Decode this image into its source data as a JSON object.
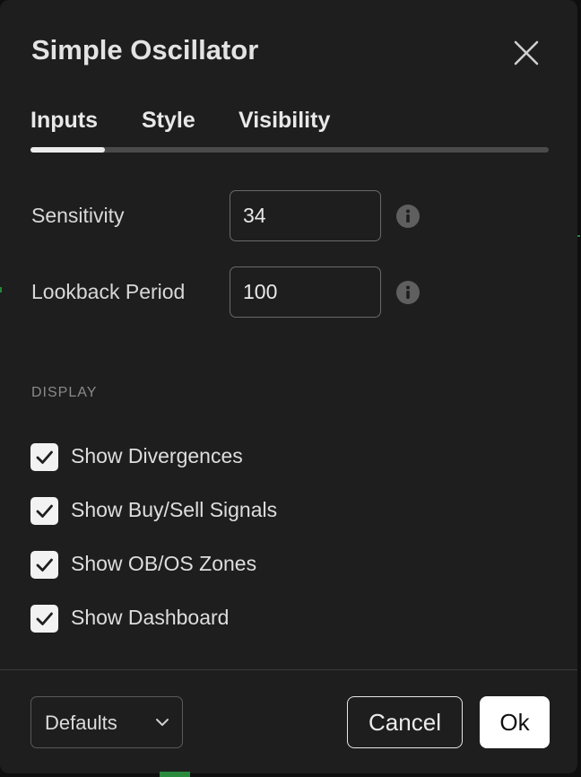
{
  "dialog": {
    "title": "Simple Oscillator",
    "close_icon": "close-icon"
  },
  "tabs": [
    {
      "label": "Inputs",
      "active": true
    },
    {
      "label": "Style",
      "active": false
    },
    {
      "label": "Visibility",
      "active": false
    }
  ],
  "inputs": {
    "sensitivity": {
      "label": "Sensitivity",
      "value": "34",
      "icon": "info-icon"
    },
    "lookback": {
      "label": "Lookback Period",
      "value": "100",
      "icon": "info-icon"
    }
  },
  "display": {
    "heading": "DISPLAY",
    "options": [
      {
        "label": "Show Divergences",
        "checked": true
      },
      {
        "label": "Show Buy/Sell Signals",
        "checked": true
      },
      {
        "label": "Show OB/OS Zones",
        "checked": true
      },
      {
        "label": "Show Dashboard",
        "checked": true
      }
    ]
  },
  "footer": {
    "defaults_label": "Defaults",
    "defaults_icon": "chevron-down-icon",
    "cancel_label": "Cancel",
    "ok_label": "Ok"
  },
  "colors": {
    "dialog_bg": "#1e1e1e",
    "checkbox": "#f2f2f2",
    "primary_button": "#ffffff"
  }
}
